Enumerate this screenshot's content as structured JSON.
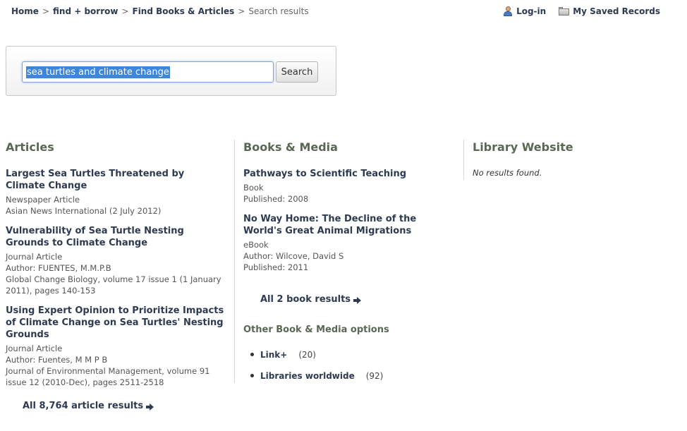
{
  "breadcrumb": {
    "items": [
      "Home",
      "find + borrow",
      "Find Books & Articles"
    ],
    "separator": ">",
    "current": "Search results"
  },
  "header": {
    "login_label": "Log-in",
    "saved_label": "My Saved Records"
  },
  "search": {
    "value": "sea turtles and climate change",
    "button_label": "Search"
  },
  "articles": {
    "heading": "Articles",
    "items": [
      {
        "title": "Largest Sea Turtles Threatened by Climate Change",
        "type": "Newspaper Article",
        "lines": [
          "Asian News International (2 July 2012)"
        ]
      },
      {
        "title": "Vulnerability of Sea Turtle Nesting Grounds to Climate Change",
        "type": "Journal Article",
        "lines": [
          "Author: FUENTES, M.M.P.B",
          "Global Change Biology, volume 17 issue 1 (1 January 2011), pages 140-153"
        ]
      },
      {
        "title": "Using Expert Opinion to Prioritize Impacts of Climate Change on Sea Turtles' Nesting Grounds",
        "type": "Journal Article",
        "lines": [
          "Author: Fuentes, M M P B",
          "Journal of Environmental Management, volume 91 issue 12 (2010-Dec), pages 2511-2518"
        ]
      }
    ],
    "all_results": "All 8,764 article results"
  },
  "books": {
    "heading": "Books & Media",
    "items": [
      {
        "title": "Pathways to Scientific Teaching",
        "type": "Book",
        "lines": [
          "Published: 2008"
        ]
      },
      {
        "title": "No Way Home: The Decline of the World's Great Animal Migrations",
        "type": "eBook",
        "lines": [
          "Author: Wilcove, David S",
          "Published: 2011"
        ]
      }
    ],
    "all_results": "All 2 book results",
    "other_heading": "Other Book & Media options",
    "other_options": [
      {
        "name": "Link+",
        "count": "(20)"
      },
      {
        "name": "Libraries worldwide",
        "count": "(92)"
      }
    ]
  },
  "website": {
    "heading": "Library Website",
    "no_results": "No results found."
  }
}
